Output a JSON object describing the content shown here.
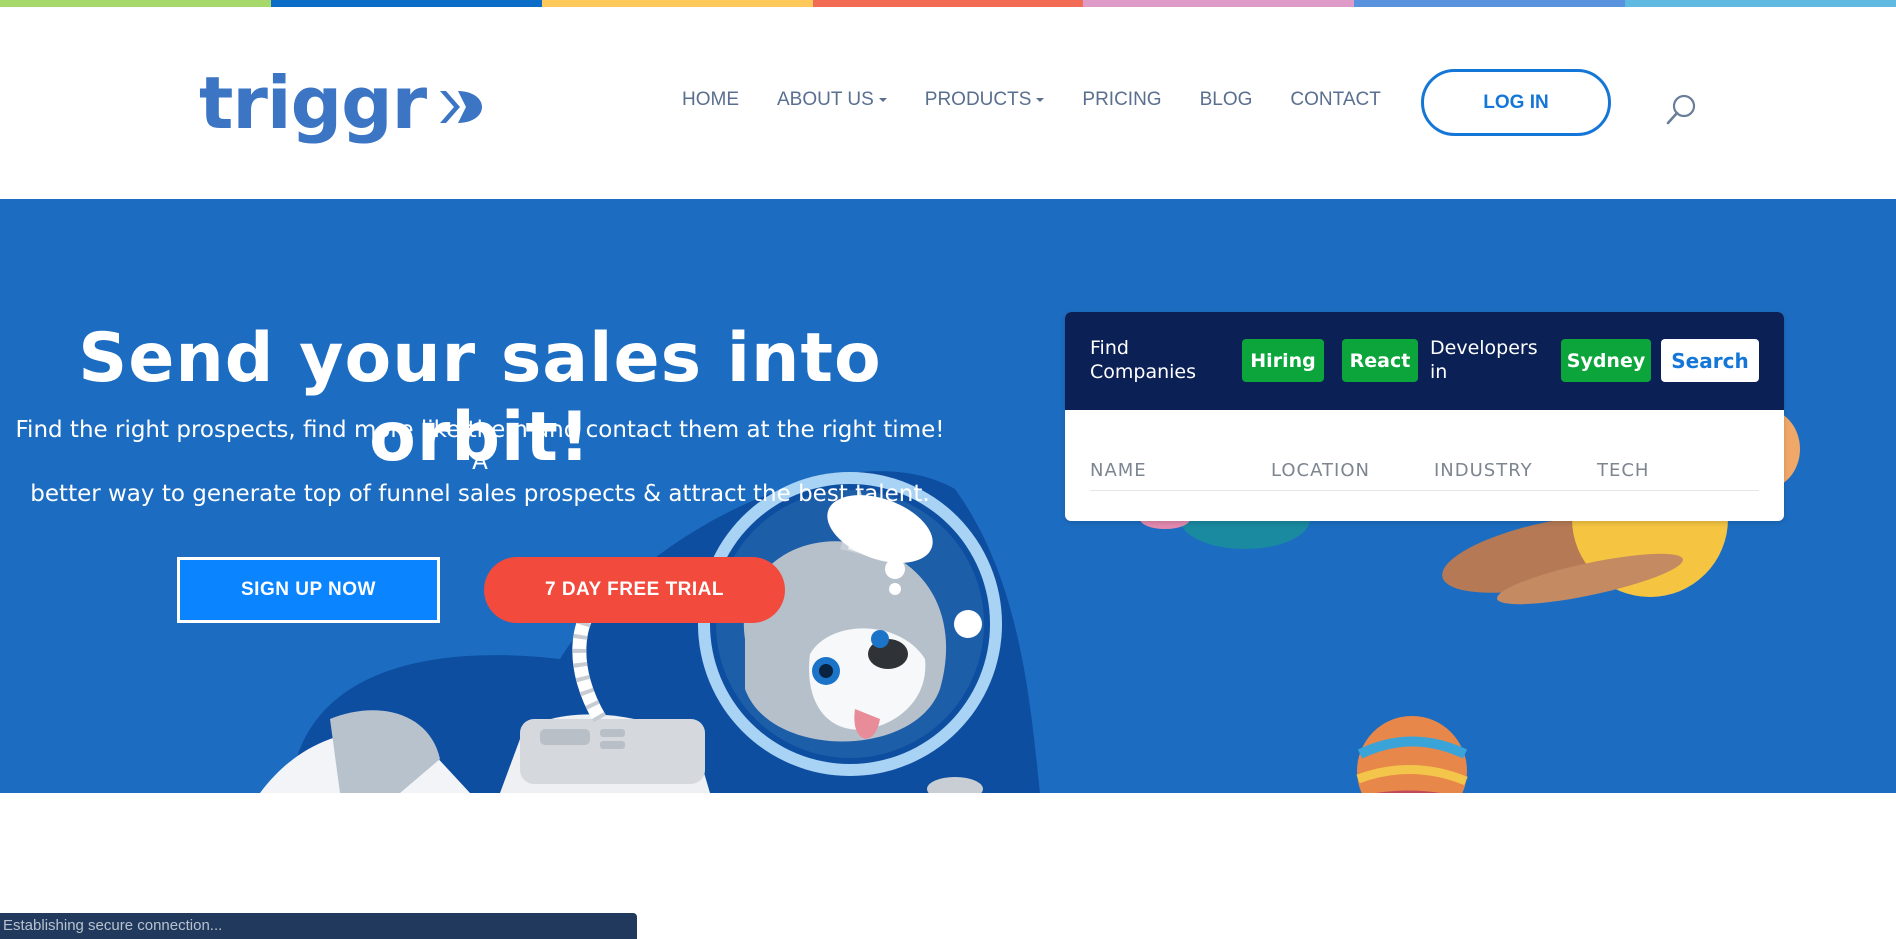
{
  "stripe_colors": [
    "#a7d86b",
    "#0b6dc7",
    "#ffc85a",
    "#f26b55",
    "#de9bc8",
    "#5a93dd",
    "#5fb9e0"
  ],
  "brand": {
    "name": "triggr",
    "color": "#3b75c4",
    "accent": "#1477d8"
  },
  "nav": {
    "items": [
      {
        "label": "HOME",
        "dropdown": false
      },
      {
        "label": "ABOUT US",
        "dropdown": true
      },
      {
        "label": "PRODUCTS",
        "dropdown": true
      },
      {
        "label": "PRICING",
        "dropdown": false
      },
      {
        "label": "BLOG",
        "dropdown": false
      },
      {
        "label": "CONTACT",
        "dropdown": false
      }
    ],
    "login_label": "LOG IN",
    "search_icon": "search-icon"
  },
  "hero": {
    "title": "Send your sales into orbit!",
    "subtitle_line1": "Find the right prospects, find more like them and contact them at the right time! A",
    "subtitle_line2": "better way to generate top of funnel sales prospects & attract the best talent.",
    "signup_label": "SIGN UP NOW",
    "trial_label": "7 DAY FREE TRIAL",
    "background": "#1c6dc2"
  },
  "widget": {
    "find_line1": "Find",
    "find_line2": "Companies",
    "pill_hiring": "Hiring",
    "pill_react": "React",
    "developers_line1": "Developers",
    "developers_line2": "in",
    "pill_location": "Sydney",
    "search_label": "Search",
    "columns": [
      "NAME",
      "LOCATION",
      "INDUSTRY",
      "TECH"
    ]
  },
  "status_bar": {
    "text": "Establishing secure connection..."
  }
}
